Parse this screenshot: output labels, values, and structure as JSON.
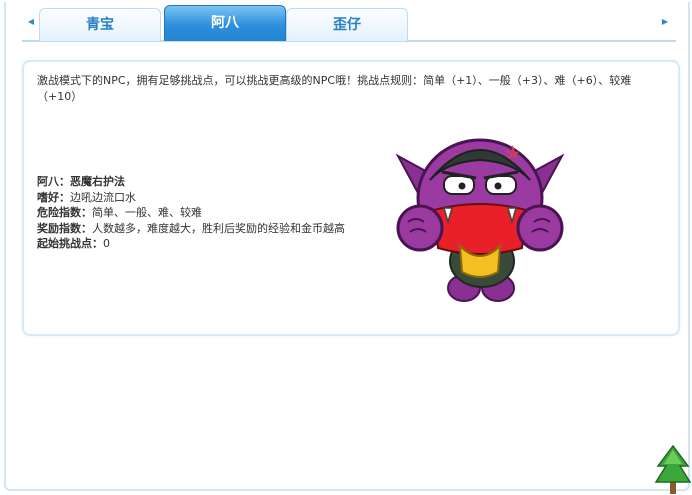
{
  "tabs": [
    {
      "label": "青宝",
      "active": false
    },
    {
      "label": "阿八",
      "active": true
    },
    {
      "label": "歪仔",
      "active": false
    }
  ],
  "nav": {
    "left_icon": "arrow-left-icon",
    "right_icon": "arrow-right-icon"
  },
  "intro": "激战模式下的NPC，拥有足够挑战点，可以挑战更高级的NPC哦！挑战点规则：简单（+1）、一般（+3）、难（+6）、较难（+10）",
  "info": [
    {
      "label": "阿八：",
      "value": "恶魔右护法"
    },
    {
      "label": "嗜好：",
      "value": "边吼边流口水"
    },
    {
      "label": "危险指数：",
      "value": "简单、一般、难、较难"
    },
    {
      "label": "奖励指数：",
      "value": "人数越多，难度越大，胜利后奖励的经验和金币越高"
    },
    {
      "label": "起始挑战点：",
      "value": "0"
    }
  ],
  "colors": {
    "accent": "#2d8fdc",
    "tab_text": "#2a7fc4",
    "border": "#d5eafa",
    "npc_body": "#9b3aa0"
  }
}
